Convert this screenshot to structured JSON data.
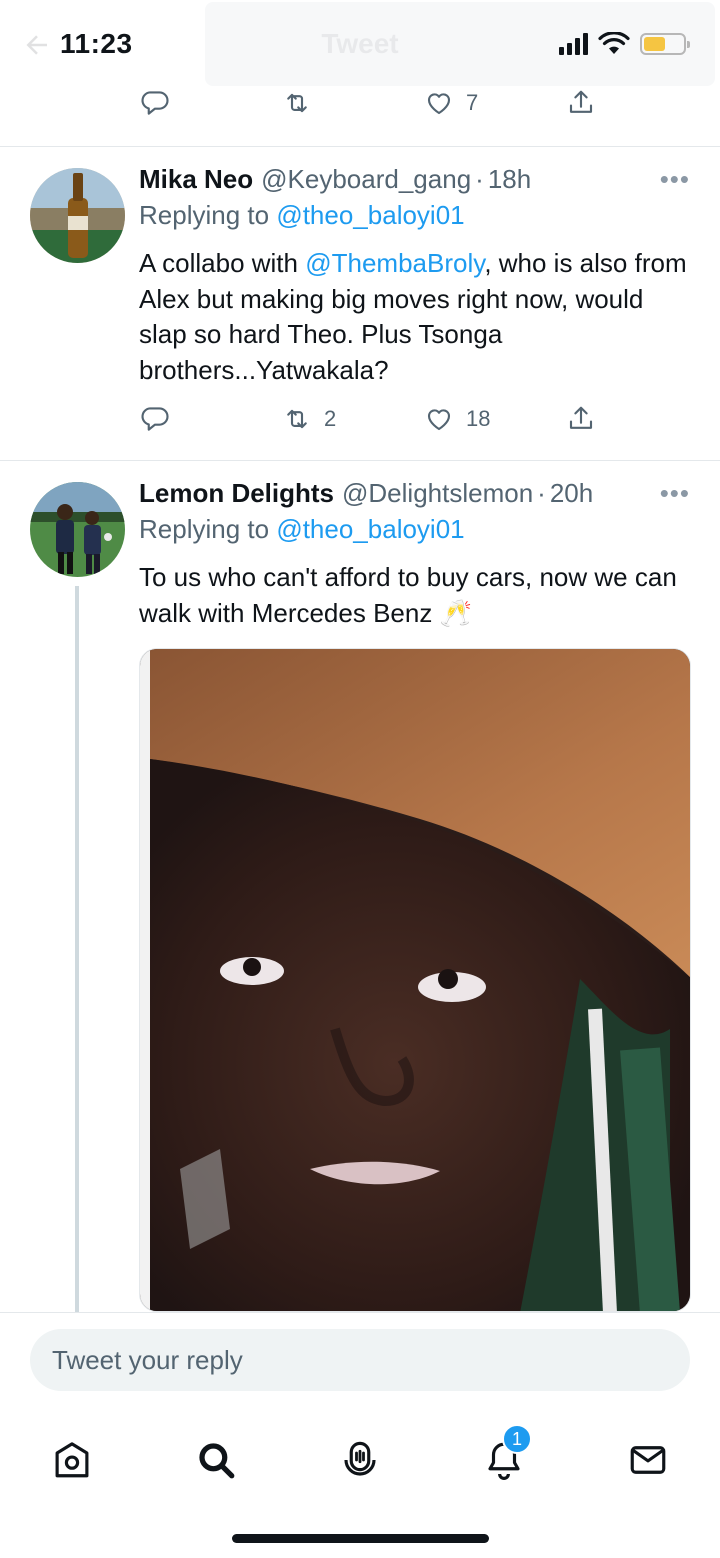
{
  "status_bar": {
    "time": "11:23",
    "header_title": "Tweet",
    "battery_color": "#f5c542"
  },
  "top_actions": {
    "reply_count": "",
    "retweet_count": "",
    "like_count": "7"
  },
  "tweets": [
    {
      "name": "Mika Neo",
      "handle": "@Keyboard_gang",
      "time": "18h",
      "replying_prefix": "Replying to ",
      "replying_to": "@theo_baloyi01",
      "text_before": "A collabo with ",
      "text_mention": "@ThembaBroly",
      "text_after": ", who is also from Alex but making big moves right now, would slap so hard Theo. Plus Tsonga brothers...Yatwakala?",
      "retweets": "2",
      "likes": "18",
      "more": "•••"
    },
    {
      "name": "Lemon Delights",
      "handle": "@Delightslemon",
      "time": "20h",
      "replying_prefix": "Replying to ",
      "replying_to": "@theo_baloyi01",
      "text": "To us who can't afford to buy cars, now we can walk with Mercedes Benz 🥂",
      "more": "•••"
    }
  ],
  "reply": {
    "placeholder": "Tweet your reply"
  },
  "tabs": {
    "notifications_badge": "1"
  },
  "colors": {
    "accent": "#1d9bf0",
    "secondary_text": "#536471",
    "divider": "#e4e8eb"
  }
}
